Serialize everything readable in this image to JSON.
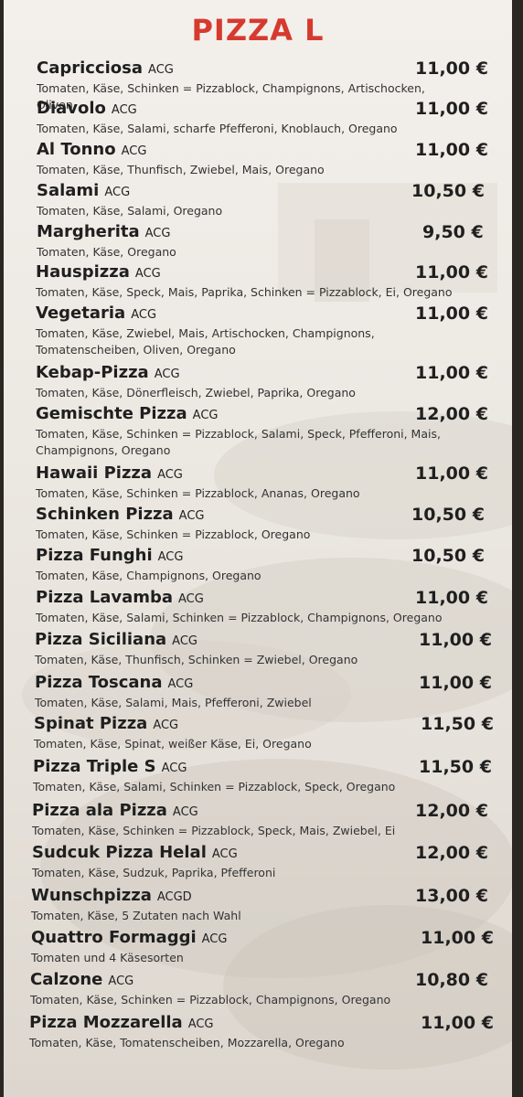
{
  "title": "PIZZA L",
  "items": [
    {
      "name": "Capricciosa",
      "code": "ACG",
      "price": "11,00 €",
      "desc": "Tomaten, Käse, Schinken = Pizzablock, Champignons, Artischocken, Oliven"
    },
    {
      "name": "Diavolo",
      "code": "ACG",
      "price": "11,00 €",
      "desc": "Tomaten, Käse, Salami, scharfe Pfefferoni, Knoblauch, Oregano"
    },
    {
      "name": "Al Tonno",
      "code": "ACG",
      "price": "11,00 €",
      "desc": "Tomaten, Käse, Thunfisch, Zwiebel, Mais, Oregano"
    },
    {
      "name": "Salami",
      "code": "ACG",
      "price": "10,50 €",
      "desc": "Tomaten, Käse, Salami, Oregano"
    },
    {
      "name": "Margherita",
      "code": "ACG",
      "price": "9,50 €",
      "desc": "Tomaten, Käse, Oregano"
    },
    {
      "name": "Hauspizza",
      "code": "ACG",
      "price": "11,00 €",
      "desc": "Tomaten, Käse, Speck, Mais, Paprika, Schinken = Pizzablock, Ei, Oregano"
    },
    {
      "name": "Vegetaria",
      "code": "ACG",
      "price": "11,00 €",
      "desc": "Tomaten, Käse, Zwiebel, Mais, Artischocken, Champignons, Tomatenscheiben, Oliven, Oregano"
    },
    {
      "name": "Kebap-Pizza",
      "code": "ACG",
      "price": "11,00 €",
      "desc": "Tomaten, Käse, Dönerfleisch, Zwiebel, Paprika, Oregano"
    },
    {
      "name": "Gemischte Pizza",
      "code": "ACG",
      "price": "12,00 €",
      "desc": "Tomaten, Käse, Schinken = Pizzablock, Salami, Speck, Pfefferoni, Mais, Champignons, Oregano"
    },
    {
      "name": "Hawaii Pizza",
      "code": "ACG",
      "price": "11,00 €",
      "desc": "Tomaten, Käse, Schinken = Pizzablock, Ananas, Oregano"
    },
    {
      "name": "Schinken Pizza",
      "code": "ACG",
      "price": "10,50 €",
      "desc": "Tomaten, Käse, Schinken = Pizzablock, Oregano"
    },
    {
      "name": "Pizza Funghi",
      "code": "ACG",
      "price": "10,50 €",
      "desc": "Tomaten, Käse, Champignons, Oregano"
    },
    {
      "name": "Pizza Lavamba",
      "code": "ACG",
      "price": "11,00 €",
      "desc": "Tomaten, Käse, Salami, Schinken = Pizzablock, Champignons, Oregano"
    },
    {
      "name": "Pizza Siciliana",
      "code": "ACG",
      "price": "11,00 €",
      "desc": "Tomaten, Käse, Thunfisch, Schinken = Zwiebel, Oregano"
    },
    {
      "name": "Pizza Toscana",
      "code": "ACG",
      "price": "11,00 €",
      "desc": "Tomaten, Käse, Salami, Mais, Pfefferoni, Zwiebel"
    },
    {
      "name": "Spinat Pizza",
      "code": "ACG",
      "price": "11,50 €",
      "desc": "Tomaten, Käse, Spinat, weißer Käse, Ei, Oregano"
    },
    {
      "name": "Pizza Triple S",
      "code": "ACG",
      "price": "11,50 €",
      "desc": "Tomaten, Käse, Salami, Schinken = Pizzablock, Speck, Oregano"
    },
    {
      "name": "Pizza ala Pizza",
      "code": "ACG",
      "price": "12,00 €",
      "desc": "Tomaten, Käse, Schinken = Pizzablock, Speck, Mais, Zwiebel, Ei"
    },
    {
      "name": "Sudcuk Pizza Helal",
      "code": "ACG",
      "price": "12,00 €",
      "desc": "Tomaten, Käse, Sudzuk, Paprika, Pfefferoni"
    },
    {
      "name": "Wunschpizza",
      "code": "ACGD",
      "price": "13,00 €",
      "desc": "Tomaten, Käse, 5 Zutaten nach Wahl"
    },
    {
      "name": "Quattro Formaggi",
      "code": "ACG",
      "price": "11,00 €",
      "desc": "Tomaten und 4 Käsesorten"
    },
    {
      "name": "Calzone",
      "code": "ACG",
      "price": "10,80 €",
      "desc": "Tomaten, Käse, Schinken = Pizzablock, Champignons, Oregano"
    },
    {
      "name": "Pizza Mozzarella",
      "code": "ACG",
      "price": "11,00 €",
      "desc": "Tomaten, Käse, Tomatenscheiben, Mozzarella, Oregano"
    }
  ]
}
